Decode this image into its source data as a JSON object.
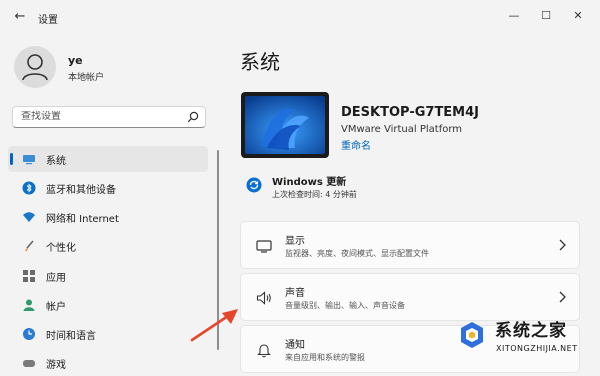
{
  "window": {
    "title": "设置",
    "back_glyph": "←",
    "min_glyph": "—",
    "max_glyph": "☐",
    "close_glyph": "✕"
  },
  "account": {
    "name": "ye",
    "type": "本地帐户"
  },
  "search": {
    "placeholder": "查找设置"
  },
  "sidebar": {
    "items": [
      {
        "label": "系统",
        "icon": "monitor-icon",
        "active": true
      },
      {
        "label": "蓝牙和其他设备",
        "icon": "bluetooth-icon"
      },
      {
        "label": "网络和 Internet",
        "icon": "wifi-icon"
      },
      {
        "label": "个性化",
        "icon": "brush-icon"
      },
      {
        "label": "应用",
        "icon": "apps-icon"
      },
      {
        "label": "帐户",
        "icon": "account-icon"
      },
      {
        "label": "时间和语言",
        "icon": "clock-globe-icon"
      },
      {
        "label": "游戏",
        "icon": "gaming-icon"
      }
    ]
  },
  "main": {
    "title": "系统",
    "device": {
      "name": "DESKTOP-G7TEM4J",
      "model": "VMware Virtual Platform",
      "rename_label": "重命名"
    },
    "update": {
      "title": "Windows 更新",
      "subtitle": "上次检查时间: 4 分钟前"
    },
    "cards": [
      {
        "title": "显示",
        "subtitle": "监视器、亮度、夜间模式、显示配置文件",
        "icon": "display-icon"
      },
      {
        "title": "声音",
        "subtitle": "音量级别、输出、输入、声音设备",
        "icon": "speaker-icon"
      },
      {
        "title": "通知",
        "subtitle": "来自应用和系统的警报",
        "icon": "bell-icon"
      }
    ]
  },
  "watermark": {
    "title": "系统之家",
    "url": "XITONGZHIJIA.NET"
  },
  "colors": {
    "accent": "#0067c0",
    "arrow": "#e8462b",
    "background": "#f3f3f3"
  }
}
